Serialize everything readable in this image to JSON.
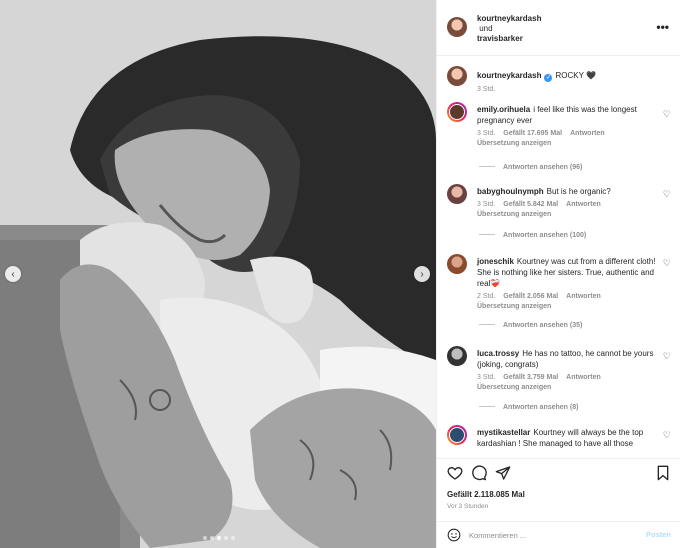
{
  "post": {
    "author": "kourtneykardash",
    "connector": "und",
    "coauthor": "travisbarker",
    "more_label": "•••",
    "caption_user": "kourtneykardash",
    "caption_text": "ROCKY 🖤",
    "caption_time": "3 Std.",
    "slides": {
      "count": 5,
      "active": 3
    }
  },
  "comments": [
    {
      "user": "emily.orihuela",
      "text": "i feel like this was the longest pregnancy ever",
      "time": "3 Std.",
      "likes": "Gefällt 17.695 Mal",
      "reply": "Antworten",
      "translate": "Übersetzung anzeigen",
      "replies": "Antworten ansehen (96)"
    },
    {
      "user": "babyghoulnymph",
      "text": "But is he organic?",
      "time": "3 Std.",
      "likes": "Gefällt 5.842 Mal",
      "reply": "Antworten",
      "translate": "Übersetzung anzeigen",
      "replies": "Antworten ansehen (100)"
    },
    {
      "user": "joneschik",
      "text": "Kourtney was cut from a different cloth! She is nothing like her sisters. True, authentic and real❤️‍🩹",
      "time": "2 Std.",
      "likes": "Gefällt 2.056 Mal",
      "reply": "Antworten",
      "translate": "Übersetzung anzeigen",
      "replies": "Antworten ansehen (35)"
    },
    {
      "user": "luca.trossy",
      "text": "He has no tattoo, he cannot be yours (joking, congrats)",
      "time": "3 Std.",
      "likes": "Gefällt 3.759 Mal",
      "reply": "Antworten",
      "translate": "Übersetzung anzeigen",
      "replies": "Antworten ansehen (8)"
    },
    {
      "user": "mystikastellar",
      "text": "Kourtney will always be the top kardashian ! She managed to have all those",
      "time": "",
      "likes": "",
      "reply": "",
      "translate": "",
      "replies": ""
    }
  ],
  "actions": {
    "likes": "Gefällt 2.118.085 Mal",
    "ago": "Vor 3 Stunden",
    "icons": [
      "heart-icon",
      "comment-icon",
      "share-icon",
      "bookmark-icon"
    ]
  },
  "composer": {
    "placeholder": "Kommentieren ...",
    "post_label": "Posten"
  },
  "colors": {
    "link": "#3897f0",
    "muted": "#8e8e8e",
    "post_disabled": "#b2dffc"
  }
}
